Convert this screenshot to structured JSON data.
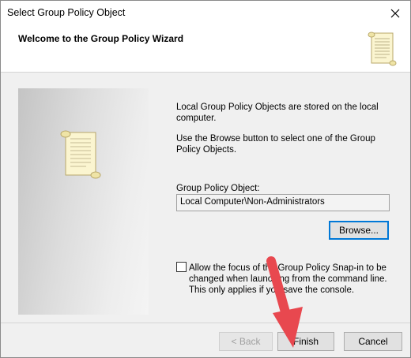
{
  "window": {
    "title": "Select Group Policy Object"
  },
  "banner": {
    "title": "Welcome to the Group Policy Wizard"
  },
  "content": {
    "intro": "Local Group Policy Objects are stored on the local computer.",
    "browse_hint": "Use the Browse button to select one of the Group Policy Objects.",
    "gpo_label": "Group Policy Object:",
    "gpo_value": "Local Computer\\Non-Administrators",
    "browse_label": "Browse...",
    "checkbox_label": "Allow the focus of the Group Policy Snap-in to be changed when launching from the command line.  This only applies if you save the console.",
    "checkbox_checked": false
  },
  "footer": {
    "back_label": "< Back",
    "finish_label": "Finish",
    "cancel_label": "Cancel"
  },
  "icons": {
    "close": "close-icon",
    "banner": "scroll-icon",
    "side": "scroll-icon",
    "annotation": "red-arrow-icon"
  },
  "colors": {
    "arrow": "#e8484f",
    "focus_border": "#0078d7"
  }
}
